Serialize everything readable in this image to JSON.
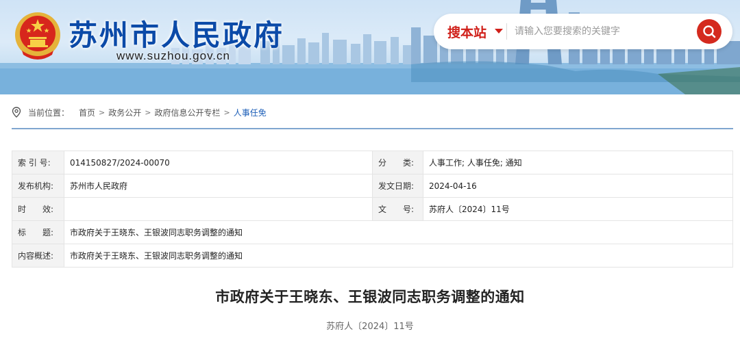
{
  "header": {
    "site_title": "苏州市人民政府",
    "site_domain": "www.suzhou.gov.cn"
  },
  "search": {
    "scope_label": "搜本站",
    "placeholder": "请输入您要搜索的关键字",
    "accent_color": "#d42a1e"
  },
  "breadcrumb": {
    "prefix": "当前位置：",
    "items": [
      "首页",
      "政务公开",
      "政府信息公开专栏"
    ],
    "current": "人事任免",
    "separator": ">"
  },
  "meta": {
    "index_label": "索 引 号:",
    "index_value": "014150827/2024-00070",
    "category_label": "分　　类:",
    "category_value": "人事工作;  人事任免;  通知",
    "publisher_label": "发布机构:",
    "publisher_value": "苏州市人民政府",
    "date_label": "发文日期:",
    "date_value": "2024-04-16",
    "validity_label": "时　　效:",
    "validity_value": "",
    "docno_label": "文　　号:",
    "docno_value": "苏府人〔2024〕11号",
    "title_label": "标　　题:",
    "title_value": "市政府关于王晓东、王银波同志职务调整的通知",
    "summary_label": "内容概述:",
    "summary_value": "市政府关于王晓东、王银波同志职务调整的通知"
  },
  "article": {
    "title": "市政府关于王晓东、王银波同志职务调整的通知",
    "doc_number": "苏府人〔2024〕11号"
  },
  "icons": {
    "emblem": "national-emblem-icon",
    "search": "search-icon",
    "location": "location-pin-icon",
    "dropdown": "caret-down-icon"
  }
}
